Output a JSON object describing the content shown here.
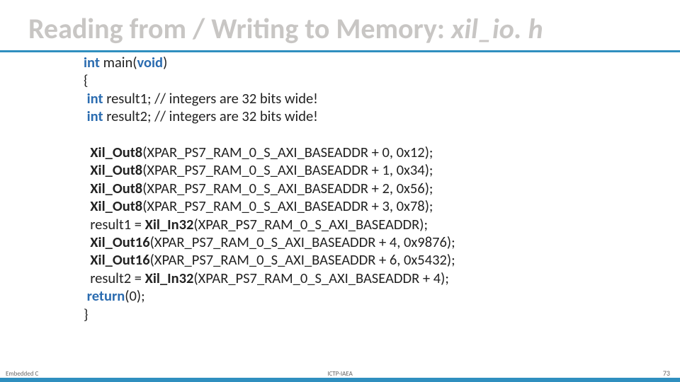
{
  "title": {
    "prefix": "Reading from / Writing to Memory: ",
    "file": "xil_io. h"
  },
  "code": {
    "l01_int": "int",
    "l01_rest": " main(",
    "l01_void": "void",
    "l01_paren": ")",
    "l02": "{",
    "l03_int": " int",
    "l03_rest": " result1; // integers are 32 bits wide!",
    "l04_int": " int",
    "l04_rest": " result2; // integers are 32 bits wide!",
    "l06_fn": "  Xil_Out8",
    "l06_rest": "(XPAR_PS7_RAM_0_S_AXI_BASEADDR + 0, 0x12);",
    "l07_fn": "  Xil_Out8",
    "l07_rest": "(XPAR_PS7_RAM_0_S_AXI_BASEADDR + 1, 0x34);",
    "l08_fn": "  Xil_Out8",
    "l08_rest": "(XPAR_PS7_RAM_0_S_AXI_BASEADDR + 2, 0x56);",
    "l09_fn": "  Xil_Out8",
    "l09_rest": "(XPAR_PS7_RAM_0_S_AXI_BASEADDR + 3, 0x78);",
    "l10_a": "  result1 = ",
    "l10_fn": "Xil_In32",
    "l10_rest": "(XPAR_PS7_RAM_0_S_AXI_BASEADDR);",
    "l11_fn": "  Xil_Out16",
    "l11_rest": "(XPAR_PS7_RAM_0_S_AXI_BASEADDR + 4, 0x9876);",
    "l12_fn": "  Xil_Out16",
    "l12_rest": "(XPAR_PS7_RAM_0_S_AXI_BASEADDR + 6, 0x5432);",
    "l13_a": "  result2 = ",
    "l13_fn": "Xil_In32",
    "l13_rest": "(XPAR_PS7_RAM_0_S_AXI_BASEADDR + 4);",
    "l14_ret": " return",
    "l14_rest": "(0);",
    "l15": "}"
  },
  "footer": {
    "left": "Embedded C",
    "center": "ICTP-IAEA",
    "right": "73"
  }
}
